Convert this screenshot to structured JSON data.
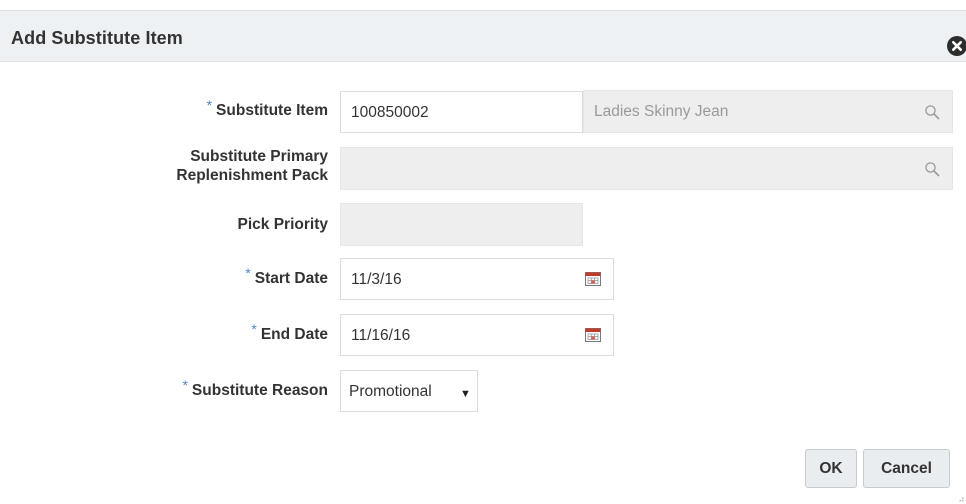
{
  "dialog": {
    "title": "Add Substitute Item",
    "close_icon": "close-circle-icon"
  },
  "form": {
    "required_marker": "*",
    "substitute_item": {
      "label": "Substitute Item",
      "required": true,
      "value": "100850002",
      "description": "Ladies Skinny Jean",
      "search_icon": "search-icon"
    },
    "primary_pack": {
      "label_line1": "Substitute Primary",
      "label_line2": "Replenishment Pack",
      "required": false,
      "value": "",
      "search_icon": "search-icon"
    },
    "pick_priority": {
      "label": "Pick Priority",
      "required": false,
      "value": ""
    },
    "start_date": {
      "label": "Start Date",
      "required": true,
      "value": "11/3/16",
      "calendar_icon": "calendar-icon"
    },
    "end_date": {
      "label": "End Date",
      "required": true,
      "value": "11/16/16",
      "calendar_icon": "calendar-icon"
    },
    "substitute_reason": {
      "label": "Substitute Reason",
      "required": true,
      "selected": "Promotional",
      "caret": "▼"
    }
  },
  "buttons": {
    "ok": "OK",
    "cancel": "Cancel"
  },
  "colors": {
    "header_bg": "#eef1f3",
    "required_marker": "#4f86c6",
    "readonly_field": "#eeeeee",
    "button_bg": "#e9edf0",
    "calendar_accent": "#c0392b"
  }
}
